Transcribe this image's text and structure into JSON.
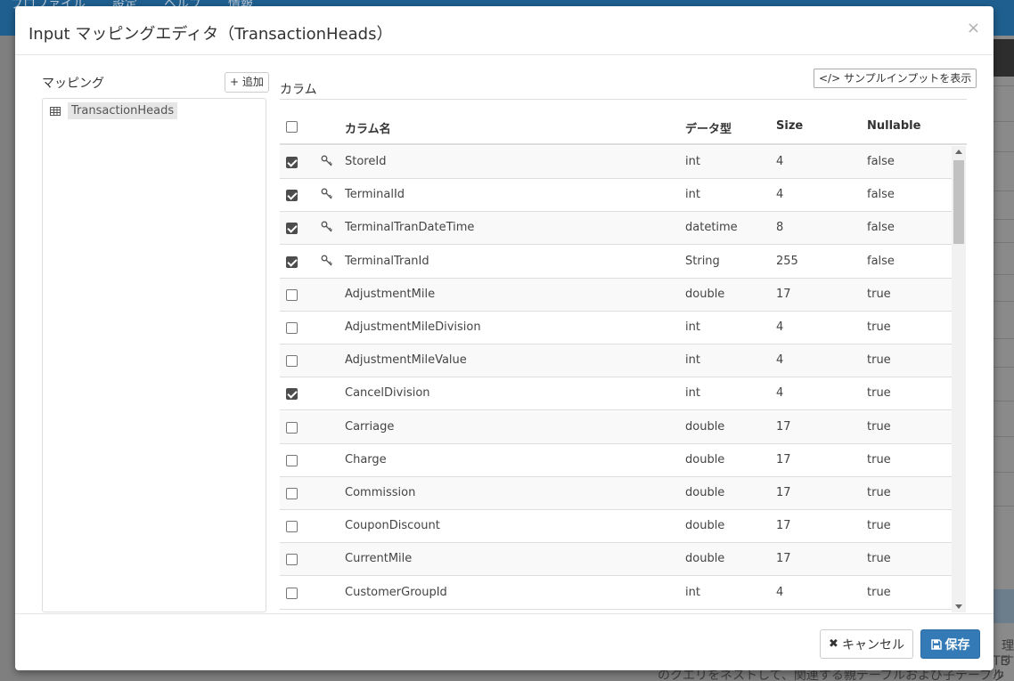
{
  "background": {
    "nav_items": [
      "プロファイル",
      "設定",
      "ヘルプ",
      "情報"
    ],
    "bottom_text": [
      "理す",
      "TE ク",
      "のクエリをネストして、関連する親テーブルおよび子テーブルへの子"
    ]
  },
  "modal": {
    "title": "Input マッピングエディタ（TransactionHeads）",
    "close_symbol": "×"
  },
  "mapping": {
    "label": "マッピング",
    "add_button": "+ 追加",
    "items": [
      "TransactionHeads"
    ]
  },
  "columns": {
    "label": "カラム",
    "sample_button": "</> サンプルインプットを表示",
    "headers": {
      "name": "カラム名",
      "type": "データ型",
      "size": "Size",
      "nullable": "Nullable"
    },
    "rows": [
      {
        "checked": true,
        "key": true,
        "name": "StoreId",
        "type": "int",
        "size": "4",
        "nullable": "false"
      },
      {
        "checked": true,
        "key": true,
        "name": "TerminalId",
        "type": "int",
        "size": "4",
        "nullable": "false"
      },
      {
        "checked": true,
        "key": true,
        "name": "TerminalTranDateTime",
        "type": "datetime",
        "size": "8",
        "nullable": "false"
      },
      {
        "checked": true,
        "key": true,
        "name": "TerminalTranId",
        "type": "String",
        "size": "255",
        "nullable": "false"
      },
      {
        "checked": false,
        "key": false,
        "name": "AdjustmentMile",
        "type": "double",
        "size": "17",
        "nullable": "true"
      },
      {
        "checked": false,
        "key": false,
        "name": "AdjustmentMileDivision",
        "type": "int",
        "size": "4",
        "nullable": "true"
      },
      {
        "checked": false,
        "key": false,
        "name": "AdjustmentMileValue",
        "type": "int",
        "size": "4",
        "nullable": "true"
      },
      {
        "checked": true,
        "key": false,
        "name": "CancelDivision",
        "type": "int",
        "size": "4",
        "nullable": "true"
      },
      {
        "checked": false,
        "key": false,
        "name": "Carriage",
        "type": "double",
        "size": "17",
        "nullable": "true"
      },
      {
        "checked": false,
        "key": false,
        "name": "Charge",
        "type": "double",
        "size": "17",
        "nullable": "true"
      },
      {
        "checked": false,
        "key": false,
        "name": "Commission",
        "type": "double",
        "size": "17",
        "nullable": "true"
      },
      {
        "checked": false,
        "key": false,
        "name": "CouponDiscount",
        "type": "double",
        "size": "17",
        "nullable": "true"
      },
      {
        "checked": false,
        "key": false,
        "name": "CurrentMile",
        "type": "double",
        "size": "17",
        "nullable": "true"
      },
      {
        "checked": false,
        "key": false,
        "name": "CustomerGroupId",
        "type": "int",
        "size": "4",
        "nullable": "true"
      }
    ]
  },
  "footer": {
    "cancel_label": "キャンセル",
    "save_label": "保存"
  }
}
